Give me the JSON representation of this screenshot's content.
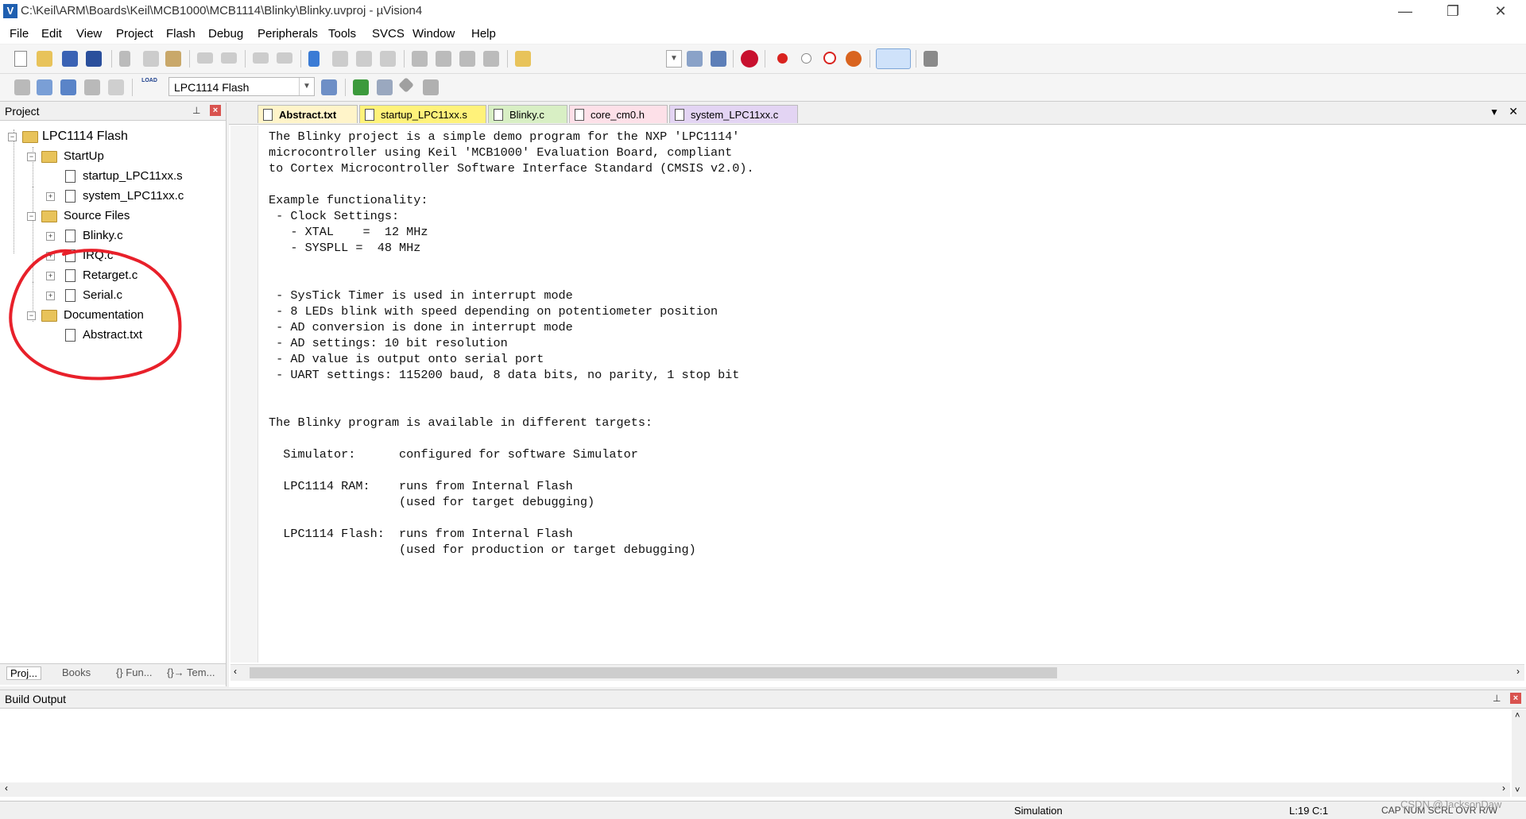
{
  "window": {
    "title": "C:\\Keil\\ARM\\Boards\\Keil\\MCB1000\\MCB1114\\Blinky\\Blinky.uvproj - µVision4",
    "logo_text": "V",
    "minimize": "—",
    "restore": "❐",
    "close": "✕"
  },
  "menu": [
    "File",
    "Edit",
    "View",
    "Project",
    "Flash",
    "Debug",
    "Peripherals",
    "Tools",
    "SVCS",
    "Window",
    "Help"
  ],
  "toolbar": {
    "target_name": "LPC1114 Flash",
    "load_label": "LOAD"
  },
  "project_panel": {
    "title": "Project",
    "pin": "📌",
    "close": "×",
    "tree": {
      "root": "LPC1114 Flash",
      "groups": [
        {
          "name": "StartUp",
          "files": [
            "startup_LPC11xx.s",
            "system_LPC11xx.c"
          ]
        },
        {
          "name": "Source Files",
          "files": [
            "Blinky.c",
            "IRQ.c",
            "Retarget.c",
            "Serial.c"
          ]
        },
        {
          "name": "Documentation",
          "files": [
            "Abstract.txt"
          ]
        }
      ]
    },
    "tabs": [
      "Proj...",
      "Books",
      "{} Fun...",
      "{}→ Tem..."
    ]
  },
  "editor": {
    "tabs": [
      {
        "label": "Abstract.txt",
        "color": "#fff4c9",
        "active": true
      },
      {
        "label": "startup_LPC11xx.s",
        "color": "#fff27a",
        "active": false
      },
      {
        "label": "Blinky.c",
        "color": "#d8efc4",
        "active": false
      },
      {
        "label": "core_cm0.h",
        "color": "#fde0e8",
        "active": false
      },
      {
        "label": "system_LPC11xx.c",
        "color": "#e3d4f3",
        "active": false
      }
    ],
    "menu_arrow": "▼",
    "close": "✕",
    "content": "The Blinky project is a simple demo program for the NXP 'LPC1114'\nmicrocontroller using Keil 'MCB1000' Evaluation Board, compliant\nto Cortex Microcontroller Software Interface Standard (CMSIS v2.0).\n\nExample functionality:\n - Clock Settings:\n   - XTAL    =  12 MHz\n   - SYSPLL =  48 MHz\n\n\n - SysTick Timer is used in interrupt mode\n - 8 LEDs blink with speed depending on potentiometer position\n - AD conversion is done in interrupt mode\n - AD settings: 10 bit resolution\n - AD value is output onto serial port\n - UART settings: 115200 baud, 8 data bits, no parity, 1 stop bit\n\n\nThe Blinky program is available in different targets:\n\n  Simulator:      configured for software Simulator\n\n  LPC1114 RAM:    runs from Internal Flash\n                  (used for target debugging)\n\n  LPC1114 Flash:  runs from Internal Flash\n                  (used for production or target debugging)"
  },
  "build_output": {
    "title": "Build Output",
    "pin": "📌",
    "close": "×"
  },
  "status": {
    "mode": "Simulation",
    "position": "L:19 C:1",
    "indicators": "CAP  NUM  SCRL  OVR  R/W",
    "watermark": "CSDN @JacksonDaw"
  },
  "colors": {
    "annotation": "#e8202a",
    "close_red": "#d9534f"
  }
}
